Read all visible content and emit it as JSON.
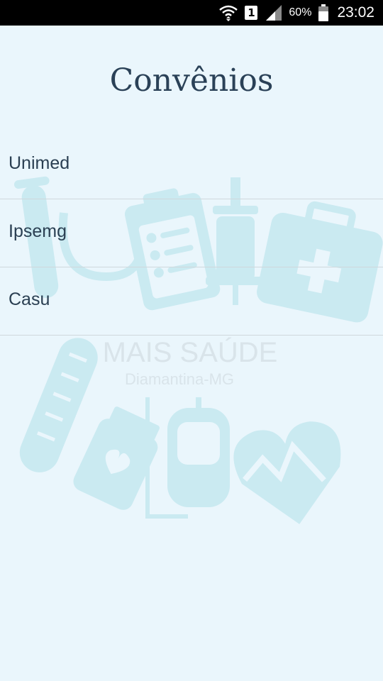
{
  "status_bar": {
    "wifi_icon": "wifi-icon",
    "sim_label": "1",
    "signal_icon": "signal-icon",
    "battery_percent": "60%",
    "battery_icon": "battery-icon",
    "time": "23:02"
  },
  "page": {
    "title": "Convênios"
  },
  "list": {
    "items": [
      {
        "label": "Unimed"
      },
      {
        "label": "Ipsemg"
      },
      {
        "label": "Casu"
      }
    ]
  },
  "watermark": {
    "brand": "MAIS SAÚDE",
    "location": "Diamantina-MG"
  },
  "colors": {
    "background": "#eaf6fc",
    "title": "#2a4157",
    "text": "#2a3f52",
    "divider": "#cfd8dc",
    "watermark": "#bfe6ee"
  }
}
